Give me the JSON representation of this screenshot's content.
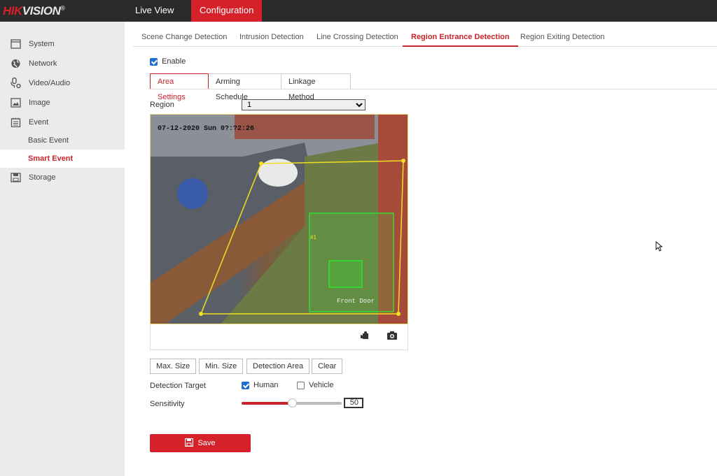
{
  "header": {
    "logo_red": "HIK",
    "logo_rest": "VISION",
    "logo_mark": "®",
    "nav": [
      {
        "label": "Live View"
      },
      {
        "label": "Configuration",
        "active": true
      }
    ]
  },
  "sidebar": {
    "items": [
      {
        "label": "System",
        "icon": "monitor-icon"
      },
      {
        "label": "Network",
        "icon": "globe-icon"
      },
      {
        "label": "Video/Audio",
        "icon": "microphone-icon"
      },
      {
        "label": "Image",
        "icon": "image-icon"
      },
      {
        "label": "Event",
        "icon": "calendar-icon"
      },
      {
        "label": "Basic Event"
      },
      {
        "label": "Smart Event",
        "selected": true
      },
      {
        "label": "Storage",
        "icon": "floppy-disk-icon"
      }
    ]
  },
  "tabs": [
    {
      "label": "Scene Change Detection"
    },
    {
      "label": "Intrusion Detection"
    },
    {
      "label": "Line Crossing Detection"
    },
    {
      "label": "Region Entrance Detection",
      "active": true
    },
    {
      "label": "Region Exiting Detection"
    }
  ],
  "enable": {
    "label": "Enable",
    "checked": true
  },
  "subtabs": [
    {
      "label": "Area Settings",
      "active": true
    },
    {
      "label": "Arming Schedule"
    },
    {
      "label": "Linkage Method"
    }
  ],
  "region": {
    "label": "Region",
    "value": "1"
  },
  "video": {
    "timestamp": "07-12-2020 Sun 0?:?2:26",
    "overlay_label": "Front Door",
    "region_color": "#f0e020",
    "size_color": "#30e030"
  },
  "buttons": {
    "max_size": "Max. Size",
    "min_size": "Min. Size",
    "detection_area": "Detection Area",
    "clear": "Clear"
  },
  "detection_target": {
    "label": "Detection Target",
    "human": {
      "label": "Human",
      "checked": true
    },
    "vehicle": {
      "label": "Vehicle",
      "checked": false
    }
  },
  "sensitivity": {
    "label": "Sensitivity",
    "value": "50",
    "max": 100
  },
  "save_label": "Save",
  "accent": "#d5222a"
}
